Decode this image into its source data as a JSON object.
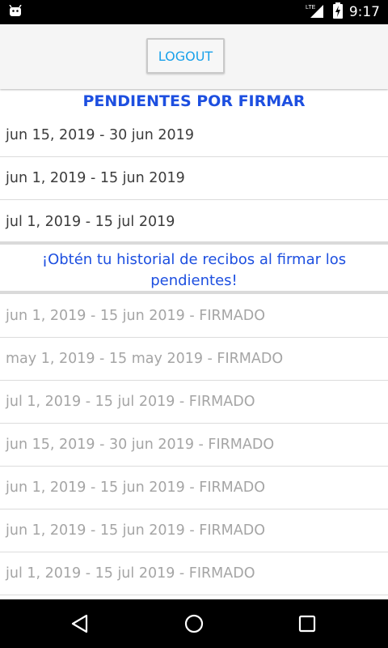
{
  "status_bar": {
    "time": "9:17",
    "network": "LTE",
    "icons": [
      "android-icon",
      "lte-signal-icon",
      "battery-charging-icon"
    ]
  },
  "header": {
    "logout_label": "LOGOUT"
  },
  "pending": {
    "title": "PENDIENTES POR FIRMAR",
    "items": [
      {
        "label": "jun 15, 2019 - 30 jun 2019"
      },
      {
        "label": "jun 1, 2019 - 15 jun 2019"
      },
      {
        "label": "jul 1, 2019 - 15 jul 2019"
      }
    ]
  },
  "notice": {
    "text": "¡Obtén tu historial de recibos al firmar los pendientes!"
  },
  "signed": {
    "items": [
      {
        "label": "jun 1, 2019 - 15 jun 2019 - FIRMADO"
      },
      {
        "label": "may 1, 2019 - 15 may 2019 - FIRMADO"
      },
      {
        "label": "jul 1, 2019 - 15 jul 2019 - FIRMADO"
      },
      {
        "label": "jun 15, 2019 - 30 jun 2019 - FIRMADO"
      },
      {
        "label": "jun 1, 2019 - 15 jun 2019 - FIRMADO"
      },
      {
        "label": "jun 1, 2019 - 15 jun 2019 - FIRMADO"
      },
      {
        "label": "jul 1, 2019 - 15 jul 2019 - FIRMADO"
      }
    ]
  },
  "nav_bar": {
    "icons": [
      "back-icon",
      "home-icon",
      "recents-icon"
    ]
  },
  "colors": {
    "accent_blue": "#1d4fe0",
    "button_text": "#1aa1ea",
    "pending_text": "#3c3c3c",
    "signed_text": "#a5a5a5"
  }
}
